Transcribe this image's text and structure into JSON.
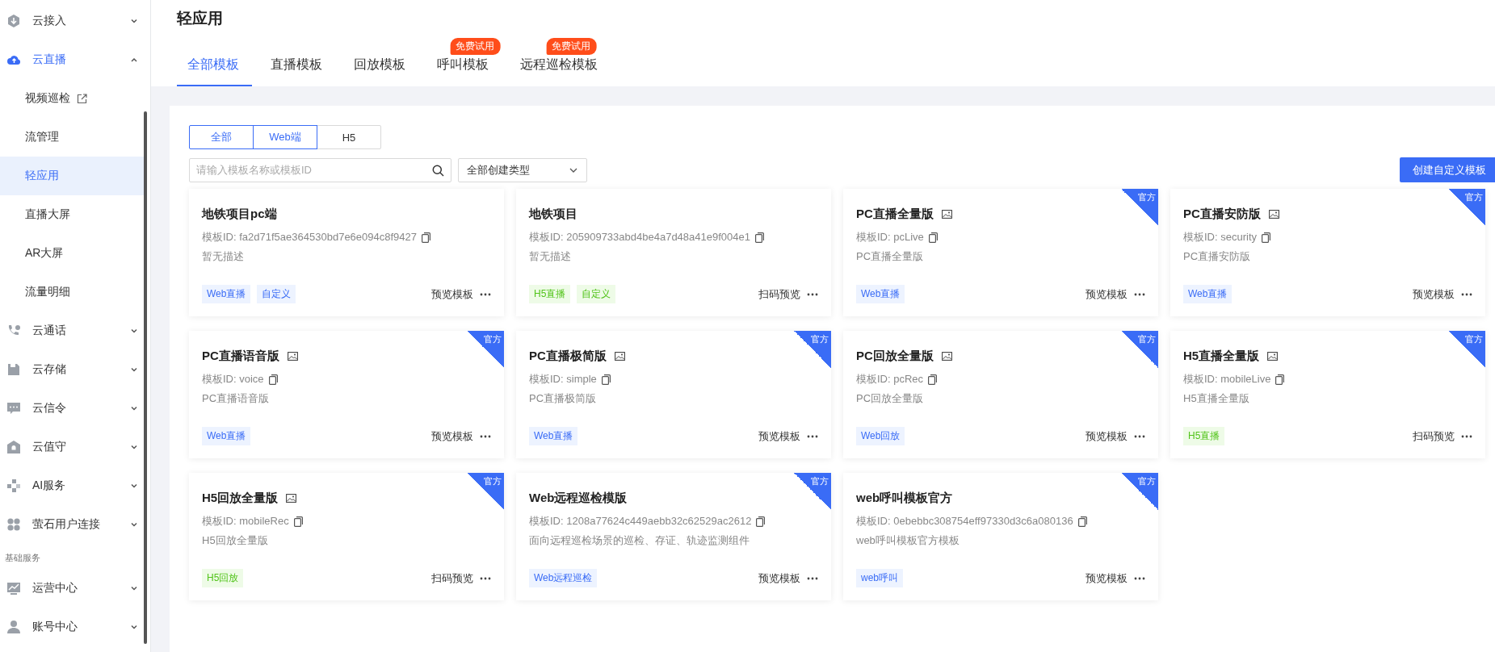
{
  "sidebar": {
    "items": [
      {
        "kind": "group",
        "label": "云接入",
        "expanded": false
      },
      {
        "kind": "group",
        "label": "云直播",
        "expanded": true,
        "selected": true,
        "children": [
          {
            "label": "视频巡检",
            "external": true,
            "selected": false
          },
          {
            "label": "流管理",
            "external": false,
            "selected": false
          },
          {
            "label": "轻应用",
            "external": false,
            "selected": true
          },
          {
            "label": "直播大屏",
            "external": false,
            "selected": false
          },
          {
            "label": "AR大屏",
            "external": false,
            "selected": false
          },
          {
            "label": "流量明细",
            "external": false,
            "selected": false
          }
        ]
      },
      {
        "kind": "group",
        "label": "云通话",
        "expanded": false
      },
      {
        "kind": "group",
        "label": "云存储",
        "expanded": false
      },
      {
        "kind": "group",
        "label": "云信令",
        "expanded": false
      },
      {
        "kind": "group",
        "label": "云值守",
        "expanded": false
      },
      {
        "kind": "group",
        "label": "AI服务",
        "expanded": false
      },
      {
        "kind": "group",
        "label": "萤石用户连接",
        "expanded": false
      },
      {
        "kind": "section",
        "label": "基础服务"
      },
      {
        "kind": "group",
        "label": "运营中心",
        "expanded": false
      },
      {
        "kind": "group",
        "label": "账号中心",
        "expanded": false
      }
    ]
  },
  "page": {
    "title": "轻应用",
    "tabs": [
      {
        "label": "全部模板",
        "selected": true
      },
      {
        "label": "直播模板",
        "selected": false
      },
      {
        "label": "回放模板",
        "selected": false
      },
      {
        "label": "呼叫模板",
        "selected": false,
        "badge": "免费试用"
      },
      {
        "label": "远程巡检模板",
        "selected": false,
        "badge": "免费试用"
      }
    ]
  },
  "filters": {
    "segments": [
      {
        "label": "全部",
        "selected": true
      },
      {
        "label": "Web端",
        "selected": true
      },
      {
        "label": "H5",
        "selected": false
      }
    ],
    "search": {
      "placeholder": "请输入模板名称或模板ID"
    },
    "type_select": {
      "value": "全部创建类型"
    },
    "create_button": "创建自定义模板"
  },
  "cards": [
    {
      "title": "地铁项目pc端",
      "preview_icon": false,
      "id_label": "模板ID:",
      "id": "fa2d71f5ae364530bd7e6e094c8f9427",
      "description": "暂无描述",
      "tags": [
        {
          "label": "Web直播",
          "color": "#3a6cf6"
        },
        {
          "label": "自定义",
          "color": "#3a6cf6"
        }
      ],
      "action": "预览模板"
    },
    {
      "title": "地铁项目",
      "preview_icon": false,
      "id_label": "模板ID:",
      "id": "205909733abd4be4a7d48a41e9f004e1",
      "description": "暂无描述",
      "tags": [
        {
          "label": "H5直播",
          "color": "#52c41a"
        },
        {
          "label": "自定义",
          "color": "#52c41a"
        }
      ],
      "action": "扫码预览"
    },
    {
      "title": "PC直播全量版",
      "preview_icon": true,
      "ribbon": "官方",
      "id_label": "模板ID:",
      "id": "pcLive",
      "description": "PC直播全量版",
      "tags": [
        {
          "label": "Web直播",
          "color": "#3a6cf6"
        }
      ],
      "action": "预览模板"
    },
    {
      "title": "PC直播安防版",
      "preview_icon": true,
      "ribbon": "官方",
      "id_label": "模板ID:",
      "id": "security",
      "description": "PC直播安防版",
      "tags": [
        {
          "label": "Web直播",
          "color": "#3a6cf6"
        }
      ],
      "action": "预览模板"
    },
    {
      "title": "PC直播语音版",
      "preview_icon": true,
      "ribbon": "官方",
      "id_label": "模板ID:",
      "id": "voice",
      "description": "PC直播语音版",
      "tags": [
        {
          "label": "Web直播",
          "color": "#3a6cf6"
        }
      ],
      "action": "预览模板"
    },
    {
      "title": "PC直播极简版",
      "preview_icon": true,
      "ribbon": "官方",
      "id_label": "模板ID:",
      "id": "simple",
      "description": "PC直播极简版",
      "tags": [
        {
          "label": "Web直播",
          "color": "#3a6cf6"
        }
      ],
      "action": "预览模板"
    },
    {
      "title": "PC回放全量版",
      "preview_icon": true,
      "ribbon": "官方",
      "id_label": "模板ID:",
      "id": "pcRec",
      "description": "PC回放全量版",
      "tags": [
        {
          "label": "Web回放",
          "color": "#3a6cf6"
        }
      ],
      "action": "预览模板"
    },
    {
      "title": "H5直播全量版",
      "preview_icon": true,
      "ribbon": "官方",
      "id_label": "模板ID:",
      "id": "mobileLive",
      "description": "H5直播全量版",
      "tags": [
        {
          "label": "H5直播",
          "color": "#52c41a"
        }
      ],
      "action": "扫码预览"
    },
    {
      "title": "H5回放全量版",
      "preview_icon": true,
      "ribbon": "官方",
      "id_label": "模板ID:",
      "id": "mobileRec",
      "description": "H5回放全量版",
      "tags": [
        {
          "label": "H5回放",
          "color": "#52c41a"
        }
      ],
      "action": "扫码预览"
    },
    {
      "title": "Web远程巡检模版",
      "preview_icon": false,
      "ribbon": "官方",
      "id_label": "模板ID:",
      "id": "1208a77624c449aebb32c62529ac2612",
      "description": "面向远程巡检场景的巡检、存证、轨迹监测组件",
      "tags": [
        {
          "label": "Web远程巡检",
          "color": "#3a6cf6"
        }
      ],
      "action": "预览模板"
    },
    {
      "title": "web呼叫模板官方",
      "preview_icon": false,
      "ribbon": "官方",
      "id_label": "模板ID:",
      "id": "0ebebbc308754eff97330d3c6a080136",
      "description": "web呼叫模板官方模板",
      "tags": [
        {
          "label": "web呼叫",
          "color": "#3a6cf6"
        }
      ],
      "action": "预览模板"
    }
  ]
}
